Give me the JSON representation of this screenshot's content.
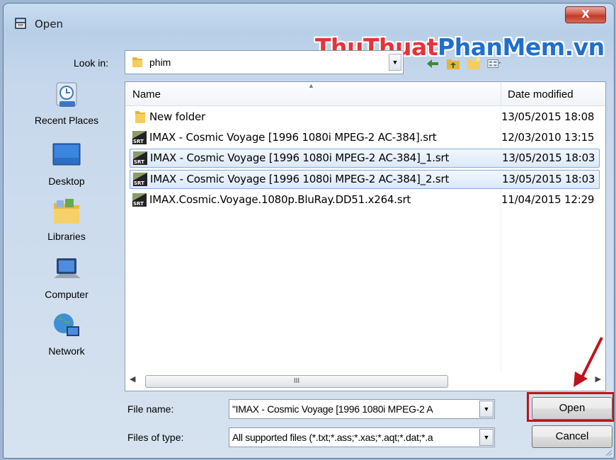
{
  "window": {
    "title": "Open",
    "close_glyph": "X"
  },
  "watermark": {
    "part1": "ThuThuat",
    "part2": "PhanMem",
    "part3": ".vn"
  },
  "lookin": {
    "label": "Look in:",
    "value": "phim"
  },
  "toolbar": {
    "icons": [
      "back-arrow-icon",
      "up-folder-icon",
      "new-folder-icon",
      "views-menu-icon"
    ]
  },
  "places": [
    {
      "label": "Recent Places",
      "icon": "recent-places-icon"
    },
    {
      "label": "Desktop",
      "icon": "desktop-icon"
    },
    {
      "label": "Libraries",
      "icon": "libraries-icon"
    },
    {
      "label": "Computer",
      "icon": "computer-icon"
    },
    {
      "label": "Network",
      "icon": "network-icon"
    }
  ],
  "filelist": {
    "columns": {
      "name": "Name",
      "date": "Date modified"
    },
    "rows": [
      {
        "name": "New folder",
        "date": "13/05/2015 18:08",
        "type": "folder",
        "selected": false
      },
      {
        "name": "IMAX - Cosmic Voyage [1996 1080i MPEG-2 AC-384].srt",
        "date": "12/03/2010 13:15",
        "type": "srt",
        "selected": false
      },
      {
        "name": "IMAX - Cosmic Voyage [1996 1080i MPEG-2 AC-384]_1.srt",
        "date": "13/05/2015 18:03",
        "type": "srt",
        "selected": true
      },
      {
        "name": "IMAX - Cosmic Voyage [1996 1080i MPEG-2 AC-384]_2.srt",
        "date": "13/05/2015 18:03",
        "type": "srt",
        "selected": true
      },
      {
        "name": "IMAX.Cosmic.Voyage.1080p.BluRay.DD51.x264.srt",
        "date": "11/04/2015 12:29",
        "type": "srt",
        "selected": false
      }
    ],
    "srt_badge": "SRT",
    "scroll_thumb_text": "III"
  },
  "filename": {
    "label": "File name:",
    "value": "\"IMAX - Cosmic Voyage [1996 1080i MPEG-2 A"
  },
  "filetype": {
    "label": "Files of type:",
    "value": "All supported files (*.txt;*.ass;*.xas;*.aqt;*.dat;*.a"
  },
  "buttons": {
    "open": "Open",
    "cancel": "Cancel"
  },
  "colors": {
    "highlight": "#c1121c",
    "selection": "#dbe9f9",
    "watermark_red": "#e8323b",
    "watermark_blue": "#1f6fcd"
  }
}
